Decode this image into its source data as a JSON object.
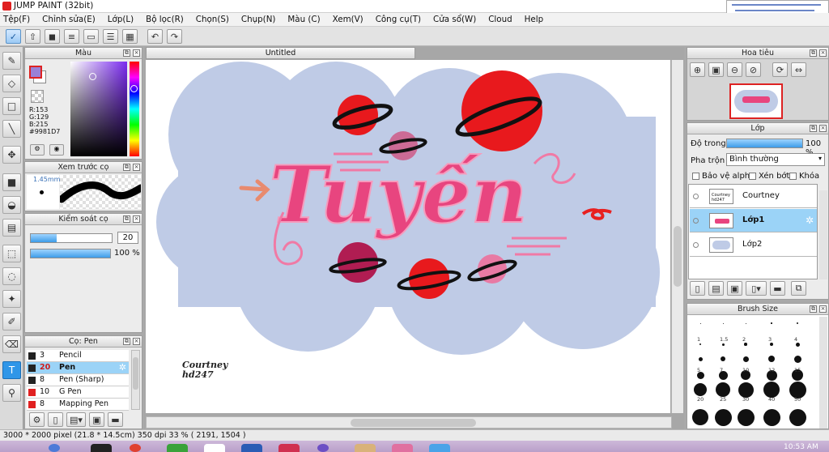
{
  "app": {
    "title": "JUMP PAINT (32bit)"
  },
  "menu": [
    "Tệp(F)",
    "Chỉnh sửa(E)",
    "Lớp(L)",
    "Bộ lọc(R)",
    "Chọn(S)",
    "Chụp(N)",
    "Màu (C)",
    "Xem(V)",
    "Công cụ(T)",
    "Cửa sổ(W)",
    "Cloud",
    "Help"
  ],
  "toolbar": {
    "icons": [
      "check-icon",
      "export-icon",
      "speech-icon",
      "notes-icon",
      "page-icon",
      "list-icon",
      "grid-icon"
    ],
    "undo": "↶",
    "redo": "↷"
  },
  "color_panel": {
    "title": "Màu",
    "r": "R:153",
    "g": "G:129",
    "b": "B:215",
    "hex": "#9981D7",
    "fg_color": "#9981D7",
    "bg_color": "#ffffff"
  },
  "brush_preview_panel": {
    "title": "Xem trước cọ",
    "size": "1.45mm"
  },
  "brush_control_panel": {
    "title": "Kiểm soát cọ",
    "size_value": "20",
    "opacity_value": "100 %",
    "size_fill": 0.32,
    "opacity_fill": 1.0
  },
  "brush_list_panel": {
    "title": "Cọ: Pen",
    "items": [
      {
        "size": "3",
        "name": "Pencil",
        "color": "#222222",
        "selected": false
      },
      {
        "size": "20",
        "name": "Pen",
        "color": "#222222",
        "selected": true
      },
      {
        "size": "8",
        "name": "Pen (Sharp)",
        "color": "#222222",
        "selected": false
      },
      {
        "size": "10",
        "name": "G Pen",
        "color": "#e02020",
        "selected": false
      },
      {
        "size": "8",
        "name": "Mapping Pen",
        "color": "#e02020",
        "selected": false
      }
    ]
  },
  "document": {
    "tab": "Untitled",
    "artwork_text": "Tuyến",
    "signature_line1": "Courtney",
    "signature_line2": "hd247"
  },
  "navigator_panel": {
    "title": "Hoa tiêu"
  },
  "layer_panel": {
    "title": "Lớp",
    "opacity_label": "Độ trong",
    "opacity_value": "100 %",
    "blend_label": "Pha trộn",
    "blend_value": "Bình thường",
    "protect_alpha": "Bảo vệ alpha",
    "clipping": "Xén bớt",
    "lock": "Khóa",
    "layers": [
      {
        "name": "Courtney",
        "selected": false
      },
      {
        "name": "Lớp1",
        "selected": true
      },
      {
        "name": "Lớp2",
        "selected": false
      }
    ]
  },
  "brush_size_panel": {
    "title": "Brush Size",
    "labels_row2": [
      "1",
      "1.5",
      "2",
      "3",
      "4"
    ],
    "labels_row4": [
      "5",
      "7",
      "10",
      "12",
      "15"
    ],
    "labels_row6": [
      "20",
      "25",
      "30",
      "40",
      "50"
    ]
  },
  "status": {
    "text": "3000 * 2000 pixel  (21.8 * 14.5cm)  350 dpi  33 %  ( 2191, 1504 )"
  },
  "taskbar": {
    "clock": "10:53 AM"
  },
  "colors": {
    "accent": "#2f96e8",
    "selection": "#9bd3f7",
    "cloud": "#bfcbe6",
    "pink": "#e8457f",
    "red": "#e8191d"
  }
}
